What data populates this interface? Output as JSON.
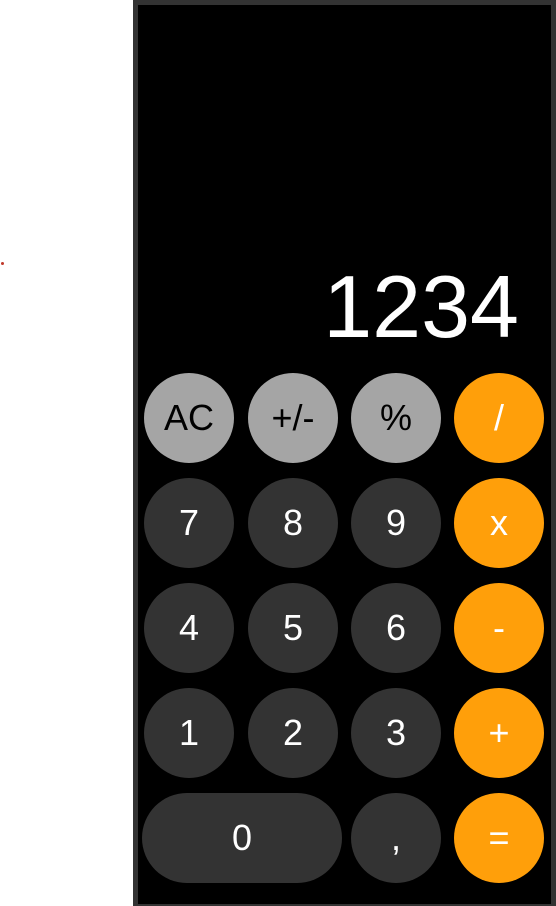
{
  "display": {
    "value": "1234"
  },
  "buttons": {
    "ac": "AC",
    "sign": "+/-",
    "percent": "%",
    "divide": "/",
    "seven": "7",
    "eight": "8",
    "nine": "9",
    "multiply": "x",
    "four": "4",
    "five": "5",
    "six": "6",
    "minus": "-",
    "one": "1",
    "two": "2",
    "three": "3",
    "plus": "+",
    "zero": "0",
    "decimal": ",",
    "equals": "="
  },
  "colors": {
    "function_key": "#a5a5a5",
    "digit_key": "#333333",
    "operator_key": "#ff9f0a",
    "background": "#000000"
  }
}
